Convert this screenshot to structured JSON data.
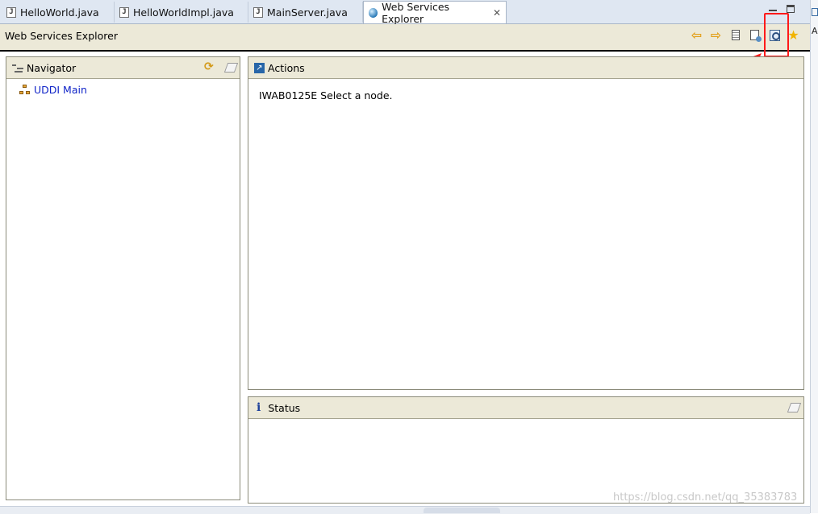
{
  "tabs": [
    {
      "label": "HelloWorld.java",
      "icon": "java-file-icon"
    },
    {
      "label": "HelloWorldImpl.java",
      "icon": "java-file-icon"
    },
    {
      "label": "MainServer.java",
      "icon": "java-file-icon"
    },
    {
      "label": "Web Services Explorer",
      "icon": "globe-icon",
      "active": true
    }
  ],
  "right_strip": {
    "letter": "A"
  },
  "toolbar": {
    "title": "Web Services Explorer",
    "buttons": [
      "back-arrow-icon",
      "forward-arrow-icon",
      "uddi-page-icon",
      "wsdl-page-icon",
      "wsil-find-icon",
      "favorites-star-icon"
    ]
  },
  "navigator": {
    "title": "Navigator",
    "tree": [
      {
        "label": "UDDI Main"
      }
    ]
  },
  "actions": {
    "title": "Actions",
    "message": "IWAB0125E Select a node."
  },
  "status": {
    "title": "Status"
  },
  "watermark": "https://blog.csdn.net/qq_35383783",
  "colors": {
    "annotation": "#ff1a1a",
    "link": "#1024c8",
    "panel_header": "#ece9d8"
  }
}
